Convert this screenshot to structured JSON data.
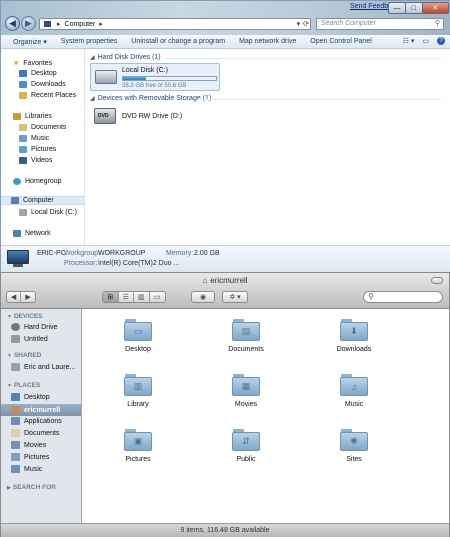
{
  "explorer": {
    "feedback_link": "Send Feedback",
    "window_buttons": [
      "—",
      "□",
      "✕"
    ],
    "nav": {
      "back_glyph": "◀",
      "forward_glyph": "▶",
      "address": "Computer",
      "search_placeholder": "Search Computer"
    },
    "commands": [
      "Organize ▾",
      "System properties",
      "Uninstall or change a program",
      "Map network drive",
      "Open Control Panel"
    ],
    "nav_pane": {
      "favorites_label": "Favorites",
      "favorites": [
        "Desktop",
        "Downloads",
        "Recent Places"
      ],
      "libraries_label": "Libraries",
      "libraries": [
        "Documents",
        "Music",
        "Pictures",
        "Videos"
      ],
      "homegroup": "Homegroup",
      "computer": "Computer",
      "local_disk": "Local Disk (C:)",
      "network": "Network"
    },
    "groups": {
      "hard_disks": "Hard Disk Drives (1)",
      "removable": "Devices with Removable Storage (1)"
    },
    "drive": {
      "name": "Local Disk (C:)",
      "free_text": "38.3 GB free of 50.6 GB",
      "used_fraction": 0.243
    },
    "dvd": {
      "name": "DVD RW Drive (D:)",
      "badge": "DVD"
    },
    "details": {
      "pc_name": "ERIC-PC",
      "workgroup_label": "Workgroup:",
      "workgroup": "WORKGROUP",
      "memory_label": "Memory:",
      "memory": "2.00 GB",
      "processor_label": "Processor:",
      "processor": "Intel(R) Core(TM)2 Duo ..."
    },
    "colors": {
      "accent": "#1e3e8c",
      "selection": "#dcebfa"
    }
  },
  "finder": {
    "title": "ericmurrell",
    "view_buttons": [
      "⊞",
      "☰",
      "▥",
      "▭"
    ],
    "sidebar": {
      "devices_label": "DEVICES",
      "devices": [
        "Hard Drive",
        "Untitled"
      ],
      "shared_label": "SHARED",
      "shared": [
        "Eric and Laure..."
      ],
      "places_label": "PLACES",
      "places": [
        "Desktop",
        "ericmurrell",
        "Applications",
        "Documents",
        "Movies",
        "Pictures",
        "Music"
      ],
      "search_label": "SEARCH FOR"
    },
    "folders": [
      "Desktop",
      "Documents",
      "Downloads",
      "Library",
      "Movies",
      "Music",
      "Pictures",
      "Public",
      "Sites"
    ],
    "folder_glyphs": [
      "▭",
      "▤",
      "⬇",
      "▥",
      "▦",
      "♫",
      "▣",
      "⇵",
      "✺"
    ],
    "status": "9 items, 116.48 GB available",
    "colors": {
      "sidebar_bg": "#e0e6ec",
      "selection": "#8aa1b8",
      "folder": "#9dc0dd"
    }
  }
}
